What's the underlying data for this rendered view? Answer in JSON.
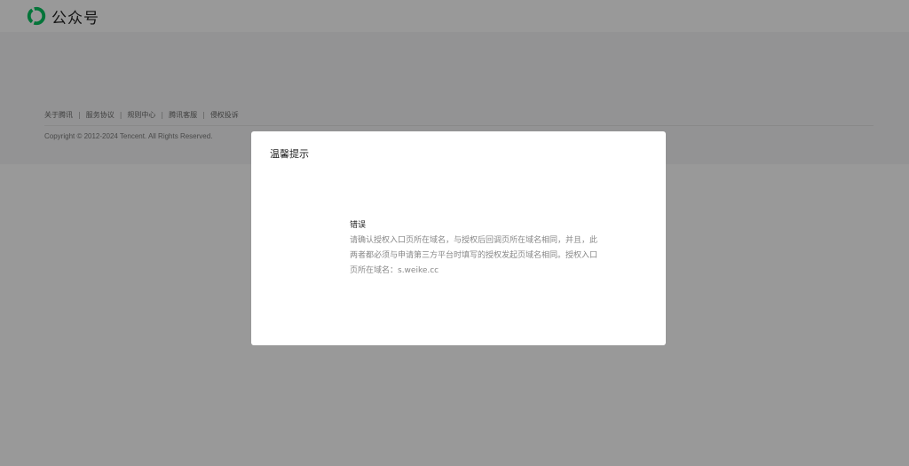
{
  "header": {
    "logo_icon": "wechat-official-account-logo-icon",
    "title": "公众号",
    "brand_color": "#07c160"
  },
  "footer": {
    "links": [
      "关于腾讯",
      "服务协议",
      "规则中心",
      "腾讯客服",
      "侵权投诉"
    ],
    "separator": "|",
    "copyright": "Copyright © 2012-2024 Tencent. All Rights Reserved."
  },
  "dialog": {
    "title": "温馨提示",
    "message_title": "错误",
    "message_body": "请确认授权入口页所在域名，与授权后回调页所在域名相同，并且，此两者都必须与申请第三方平台时填写的授权发起页域名相同。授权入口页所在域名：s.weike.cc"
  }
}
